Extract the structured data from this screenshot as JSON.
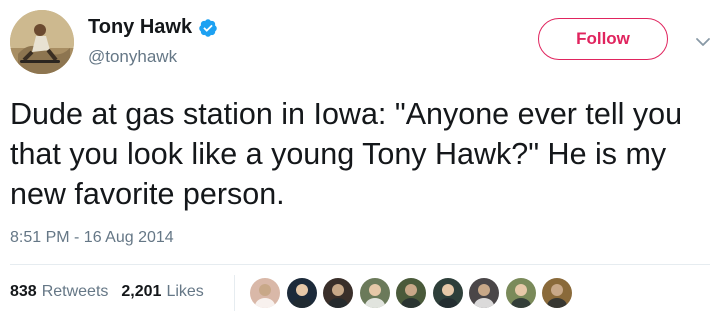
{
  "user": {
    "display_name": "Tony Hawk",
    "handle": "@tonyhawk",
    "verified": true,
    "avatar_icon": "skater-avatar"
  },
  "follow_button": {
    "label": "Follow",
    "color": "#e0245e"
  },
  "menu_icon": "chevron-down-icon",
  "tweet": {
    "text": "Dude at gas station in Iowa: \"Anyone ever tell you that you look like a young Tony Hawk?\" He is my new favorite person.",
    "timestamp": "8:51 PM - 16 Aug 2014"
  },
  "stats": {
    "retweets_count": "838",
    "retweets_label": "Retweets",
    "likes_count": "2,201",
    "likes_label": "Likes"
  },
  "liker_avatars": [
    {
      "icon": "liker-avatar-1",
      "color": "#d9b8a8"
    },
    {
      "icon": "liker-avatar-2",
      "color": "#1c2a3a"
    },
    {
      "icon": "liker-avatar-3",
      "color": "#3a2f2a"
    },
    {
      "icon": "liker-avatar-4",
      "color": "#6b7a5a"
    },
    {
      "icon": "liker-avatar-5",
      "color": "#4a5a3a"
    },
    {
      "icon": "liker-avatar-6",
      "color": "#2e3f3a"
    },
    {
      "icon": "liker-avatar-7",
      "color": "#4a4648"
    },
    {
      "icon": "liker-avatar-8",
      "color": "#7a8a5a"
    },
    {
      "icon": "liker-avatar-9",
      "color": "#8a6a3a"
    }
  ],
  "colors": {
    "text": "#14171a",
    "secondary_text": "#657786",
    "verified_blue": "#1da1f2",
    "divider": "#e6ecf0"
  }
}
